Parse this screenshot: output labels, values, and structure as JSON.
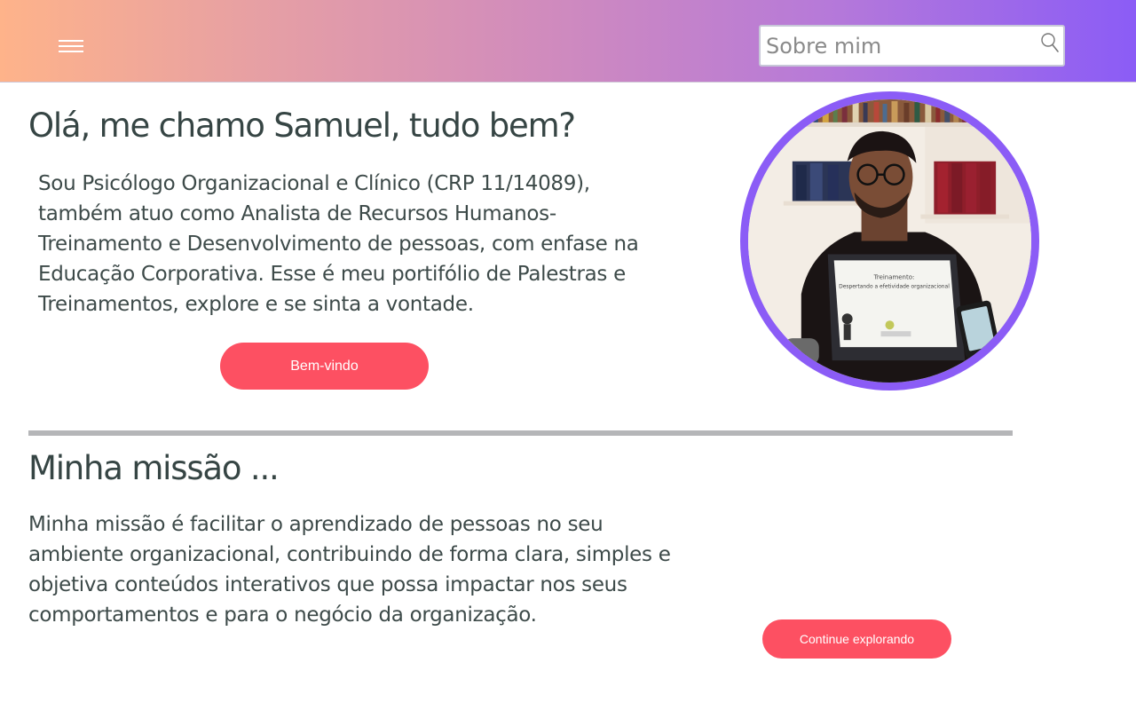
{
  "header": {
    "menu_icon": "hamburger-menu-icon",
    "search": {
      "placeholder": "Sobre mim",
      "value": "",
      "icon": "search-icon"
    }
  },
  "hero": {
    "title": "Olá, me chamo Samuel, tudo bem?",
    "text": "Sou Psicólogo Organizacional e Clínico (CRP 11/14089), também atuo como Analista de Recursos Humanos- Treinamento e Desenvolvimento de pessoas, com enfase na Educação Corporativa. Esse é meu portifólio de Palestras e Treinamentos, explore e se sinta a vontade.",
    "button_label": "Bem-vindo",
    "photo": "profile-photo",
    "laptop_screen_title": "Treinamento:",
    "laptop_screen_subtitle": "Despertando a efetividade organizacional"
  },
  "mission": {
    "title": "Minha missão ...",
    "text": "Minha missão é facilitar o aprendizado de pessoas no seu ambiente organizacional, contribuindo de forma clara, simples e objetiva conteúdos interativos que possa impactar nos seus comportamentos e para o negócio da organização.",
    "button_label": "Continue explorando"
  },
  "colors": {
    "gradient_start": "#feb38a",
    "gradient_end": "#8b5cf6",
    "button": "#fd5062",
    "avatar_ring": "#8b5cf6",
    "text": "#364544",
    "divider": "#b5b6b8"
  }
}
